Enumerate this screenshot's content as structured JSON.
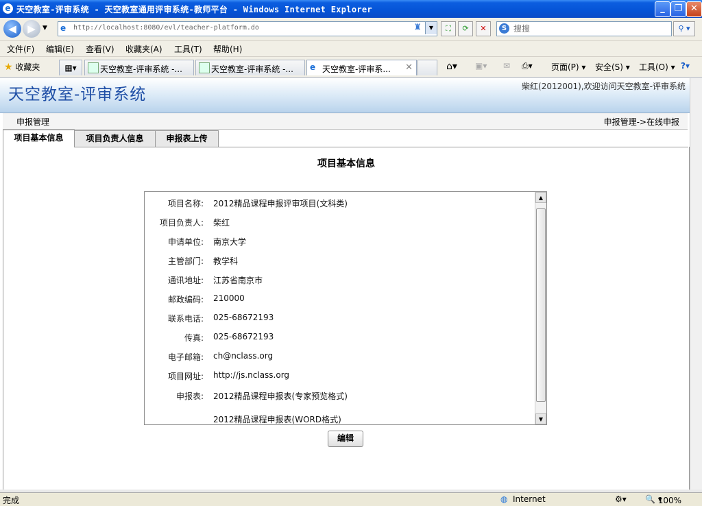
{
  "window": {
    "title": "天空教室-评审系统 - 天空教室通用评审系统-教师平台 - Windows Internet Explorer"
  },
  "browser": {
    "url": "http://localhost:8080/evl/teacher-platform.do",
    "search_placeholder": "搜搜",
    "menu": [
      "文件(F)",
      "编辑(E)",
      "查看(V)",
      "收藏夹(A)",
      "工具(T)",
      "帮助(H)"
    ],
    "favorites_label": "收藏夹",
    "tabs": [
      {
        "label": "天空教室-评审系统 -..."
      },
      {
        "label": "天空教室-评审系统 -..."
      },
      {
        "label": "天空教室-评审系..."
      }
    ],
    "toolbar_right": {
      "page": "页面(P)",
      "safety": "安全(S)",
      "tools": "工具(O)"
    },
    "status": {
      "left": "完成",
      "zone": "Internet",
      "zoom": "100%"
    }
  },
  "app": {
    "logo": "天空教室-评审系统",
    "welcome": "柴红(2012001),欢迎访问天空教室-评审系统",
    "section_left": "申报管理",
    "breadcrumb": "申报管理->在线申报",
    "tabs": [
      "项目基本信息",
      "项目负责人信息",
      "申报表上传"
    ],
    "title": "项目基本信息",
    "fields": [
      {
        "label": "项目名称:",
        "value": "2012精品课程申报评审项目(文科类)"
      },
      {
        "label": "项目负责人:",
        "value": "柴红"
      },
      {
        "label": "申请单位:",
        "value": "南京大学"
      },
      {
        "label": "主管部门:",
        "value": "教学科"
      },
      {
        "label": "通讯地址:",
        "value": "江苏省南京市"
      },
      {
        "label": "邮政编码:",
        "value": "210000"
      },
      {
        "label": "联系电话:",
        "value": "025-68672193"
      },
      {
        "label": "传真:",
        "value": "025-68672193"
      },
      {
        "label": "电子邮箱:",
        "value": "ch@nclass.org"
      },
      {
        "label": "项目网址:",
        "value": "http://js.nclass.org"
      },
      {
        "label": "申报表:",
        "value": "2012精品课程申报表(专家预览格式)"
      }
    ],
    "extra_link": "2012精品课程申报表(WORD格式)",
    "edit_button": "编辑"
  }
}
